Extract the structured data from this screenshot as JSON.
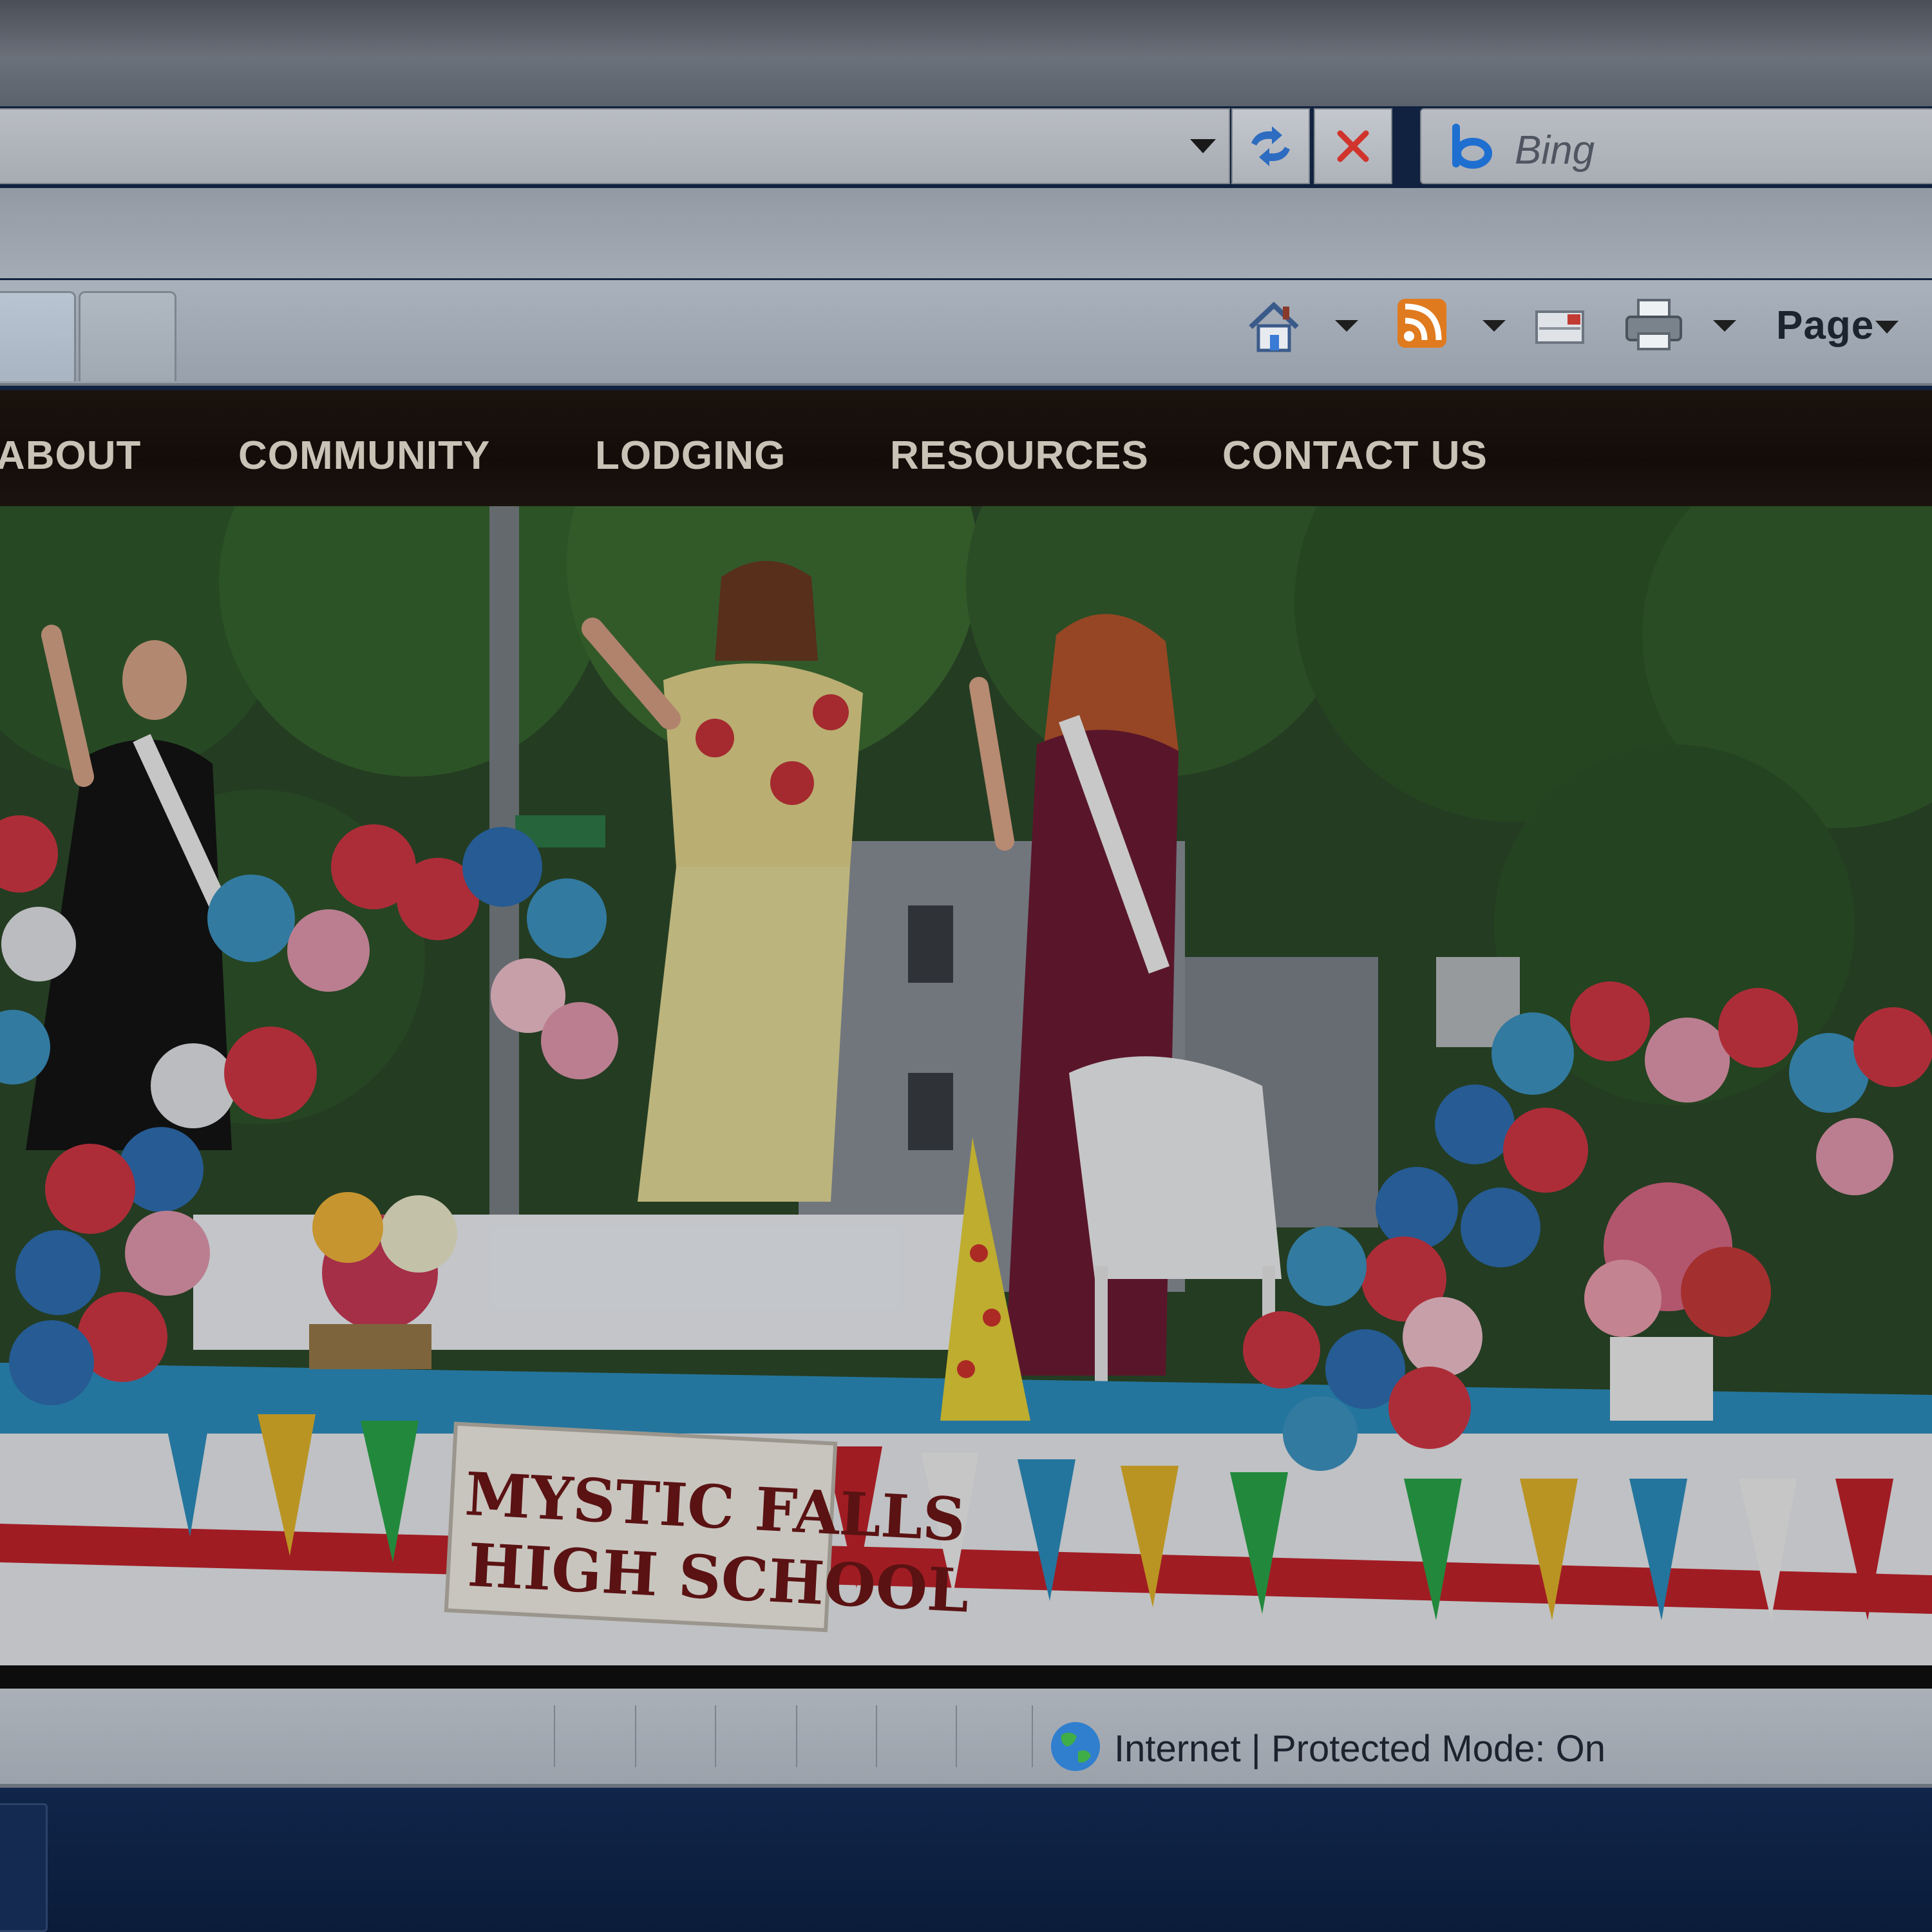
{
  "browser": {
    "search": {
      "provider": "Bing"
    },
    "command_bar": {
      "page_menu_label": "Page"
    },
    "status": {
      "zone_text": "Internet | Protected Mode: On"
    }
  },
  "site": {
    "nav_items": [
      "ABOUT",
      "COMMUNITY",
      "LODGING",
      "RESOURCES",
      "CONTACT US"
    ],
    "hero": {
      "banner_line1": "MYSTIC FALLS",
      "banner_line2": "HIGH SCHOOL"
    }
  },
  "colors": {
    "site_nav_bg": "#150f0b",
    "nav_text": "#c9c2b7",
    "banner_text": "#6e1617",
    "float_blue": "#3d95c4"
  },
  "icons": [
    "dropdown-arrow-icon",
    "refresh-icon",
    "stop-icon",
    "bing-icon",
    "home-icon",
    "rss-feed-icon",
    "mail-icon",
    "print-icon",
    "globe-icon"
  ]
}
